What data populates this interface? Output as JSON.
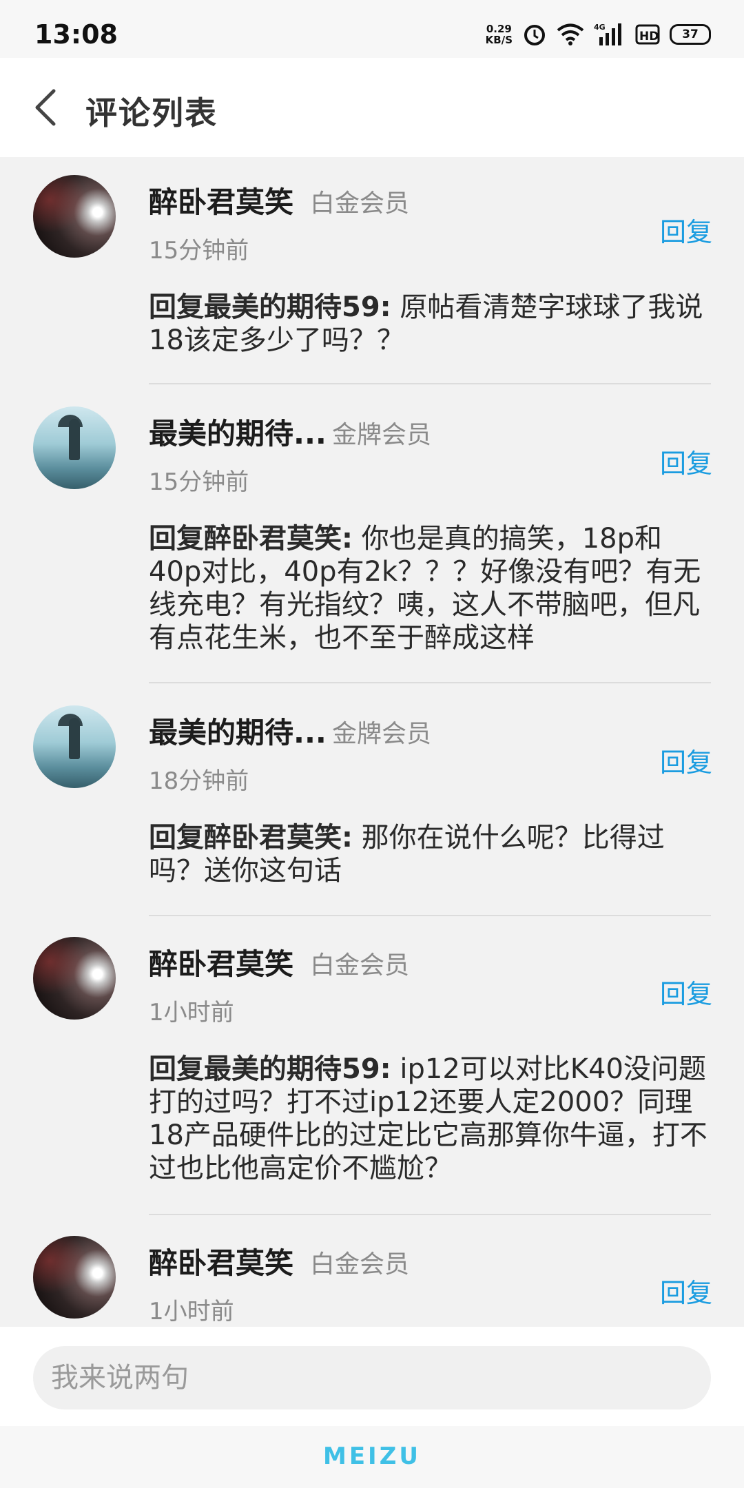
{
  "status_bar": {
    "time": "13:08",
    "net_speed_value": "0.29",
    "net_speed_unit": "KB/S",
    "network": "4G",
    "hd": "HD",
    "battery": "37"
  },
  "header": {
    "title": "评论列表"
  },
  "comments": [
    {
      "user": "醉卧君莫笑",
      "badge": "白金会员",
      "time": "15分钟前",
      "reply_label": "回复",
      "target": "回复最美的期待59:",
      "text": " 原帖看清楚字球球了我说18该定多少了吗？？",
      "avatar": "car-avatar"
    },
    {
      "user": "最美的期待...",
      "badge": "金牌会员",
      "time": "15分钟前",
      "reply_label": "回复",
      "target": "回复醉卧君莫笑:",
      "text": " 你也是真的搞笑，18p和40p对比，40p有2k？？？好像没有吧？有无线充电？有光指纹？咦，这人不带脑吧，但凡有点花生米，也不至于醉成这样",
      "avatar": "girl-umbrella-avatar"
    },
    {
      "user": "最美的期待...",
      "badge": "金牌会员",
      "time": "18分钟前",
      "reply_label": "回复",
      "target": "回复醉卧君莫笑:",
      "text": " 那你在说什么呢？比得过吗？送你这句话",
      "avatar": "girl-umbrella-avatar"
    },
    {
      "user": "醉卧君莫笑",
      "badge": "白金会员",
      "time": "1小时前",
      "reply_label": "回复",
      "target": "回复最美的期待59:",
      "text": " ip12可以对比K40没问题打的过吗？打不过ip12还要人定2000？同理18产品硬件比的过定比它高那算你牛逼，打不过也比他高定价不尴尬？",
      "avatar": "car-avatar"
    },
    {
      "user": "醉卧君莫笑",
      "badge": "白金会员",
      "time": "1小时前",
      "reply_label": "回复",
      "avatar": "car-avatar"
    }
  ],
  "input": {
    "placeholder": "我来说两句"
  },
  "nav": {
    "brand": "MEIZU"
  },
  "colors": {
    "accent": "#1a9ce0",
    "brand": "#3fc0e6"
  }
}
